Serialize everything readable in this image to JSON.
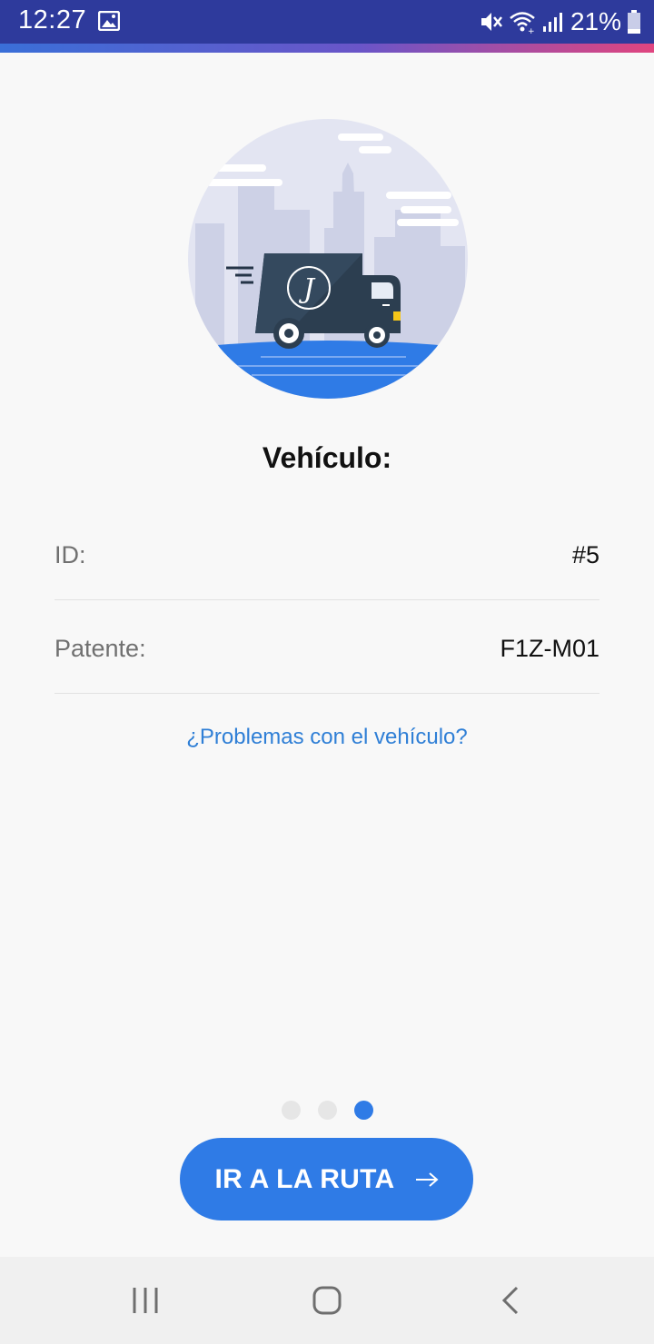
{
  "status_bar": {
    "time": "12:27",
    "battery": "21%",
    "icons": [
      "image-icon",
      "mute-icon",
      "wifi-icon",
      "signal-icon",
      "battery-icon"
    ],
    "background_color": "#2e3a9c"
  },
  "hero": {
    "illustration": "delivery-truck-city-illustration"
  },
  "vehicle": {
    "title": "Vehículo:",
    "fields": [
      {
        "label": "ID:",
        "value": "#5"
      },
      {
        "label": "Patente:",
        "value": "F1Z-M01"
      }
    ]
  },
  "problems_link": "¿Problemas con el vehículo?",
  "pager": {
    "total": 3,
    "active": 3
  },
  "cta": {
    "label": "IR A LA RUTA",
    "icon": "arrow-right-icon",
    "color": "#2f7be6"
  },
  "nav_bar": {
    "buttons": [
      "recent-apps-icon",
      "home-icon",
      "back-icon"
    ]
  },
  "colors": {
    "accent": "#2f7be6",
    "link": "#2f7fd6"
  }
}
